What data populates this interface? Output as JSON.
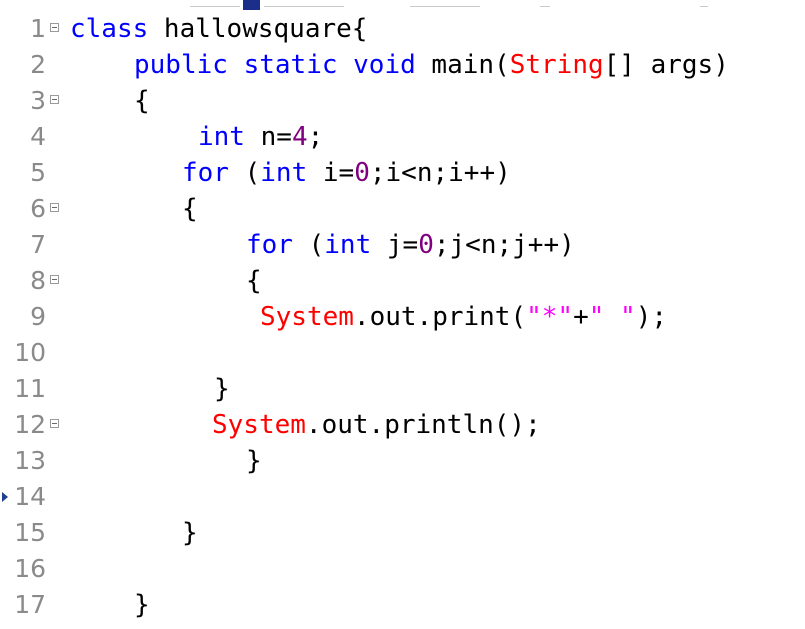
{
  "editor": {
    "line_numbers": [
      "1",
      "2",
      "3",
      "4",
      "5",
      "6",
      "7",
      "8",
      "9",
      "10",
      "11",
      "12",
      "13",
      "14",
      "15",
      "16",
      "17"
    ],
    "lines": {
      "l1_kw": "class",
      "l1_rest": " hallowsquare{",
      "l2_kw1": "public",
      "l2_kw2": "static",
      "l2_kw3": "void",
      "l2_mid": " main(",
      "l2_type": "String",
      "l2_end": "[] args)",
      "l3": "{",
      "l4_kw": "int",
      "l4_mid": " n=",
      "l4_num": "4",
      "l4_end": ";",
      "l5_kw1": "for",
      "l5_p": " (",
      "l5_kw2": "int",
      "l5_mid": " i=",
      "l5_num": "0",
      "l5_end": ";i<n;i++)",
      "l6": "{",
      "l7_kw1": "for",
      "l7_p": " (",
      "l7_kw2": "int",
      "l7_mid": " j=",
      "l7_num": "0",
      "l7_end": ";j<n;j++)",
      "l8": "{",
      "l9_cls": "System",
      "l9_mid": ".out.print(",
      "l9_s1": "\"*\"",
      "l9_plus": "+",
      "l9_s2": "\" \"",
      "l9_end": ");",
      "l11": "}",
      "l12_cls": "System",
      "l12_end": ".out.println();",
      "l13": "}",
      "l15": "}",
      "l17": "}"
    }
  },
  "colors": {
    "keyword": "#0000ff",
    "string": "#ff00ff",
    "class_name": "#ff0000",
    "number": "#800080",
    "line_number": "#8a8a8a"
  }
}
